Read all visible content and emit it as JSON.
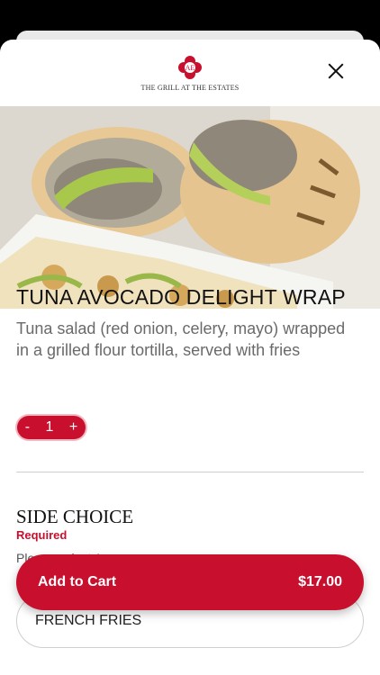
{
  "header": {
    "logo_text": "THE GRILL AT THE ESTATES",
    "logo_monogram": "AE",
    "brand_color": "#c8102e",
    "close_icon": "close-icon"
  },
  "item": {
    "title": "TUNA AVOCADO DELIGHT WRAP",
    "description": "Tuna salad (red onion, celery, mayo) wrapped in a grilled flour tortilla, served with fries"
  },
  "quantity": {
    "minus": "-",
    "value": "1",
    "plus": "+"
  },
  "side_choice": {
    "title": "SIDE CHOICE",
    "required_label": "Required",
    "hint": "Please select 1",
    "options": [
      "FRENCH FRIES"
    ]
  },
  "cart": {
    "label": "Add to Cart",
    "price": "$17.00"
  }
}
